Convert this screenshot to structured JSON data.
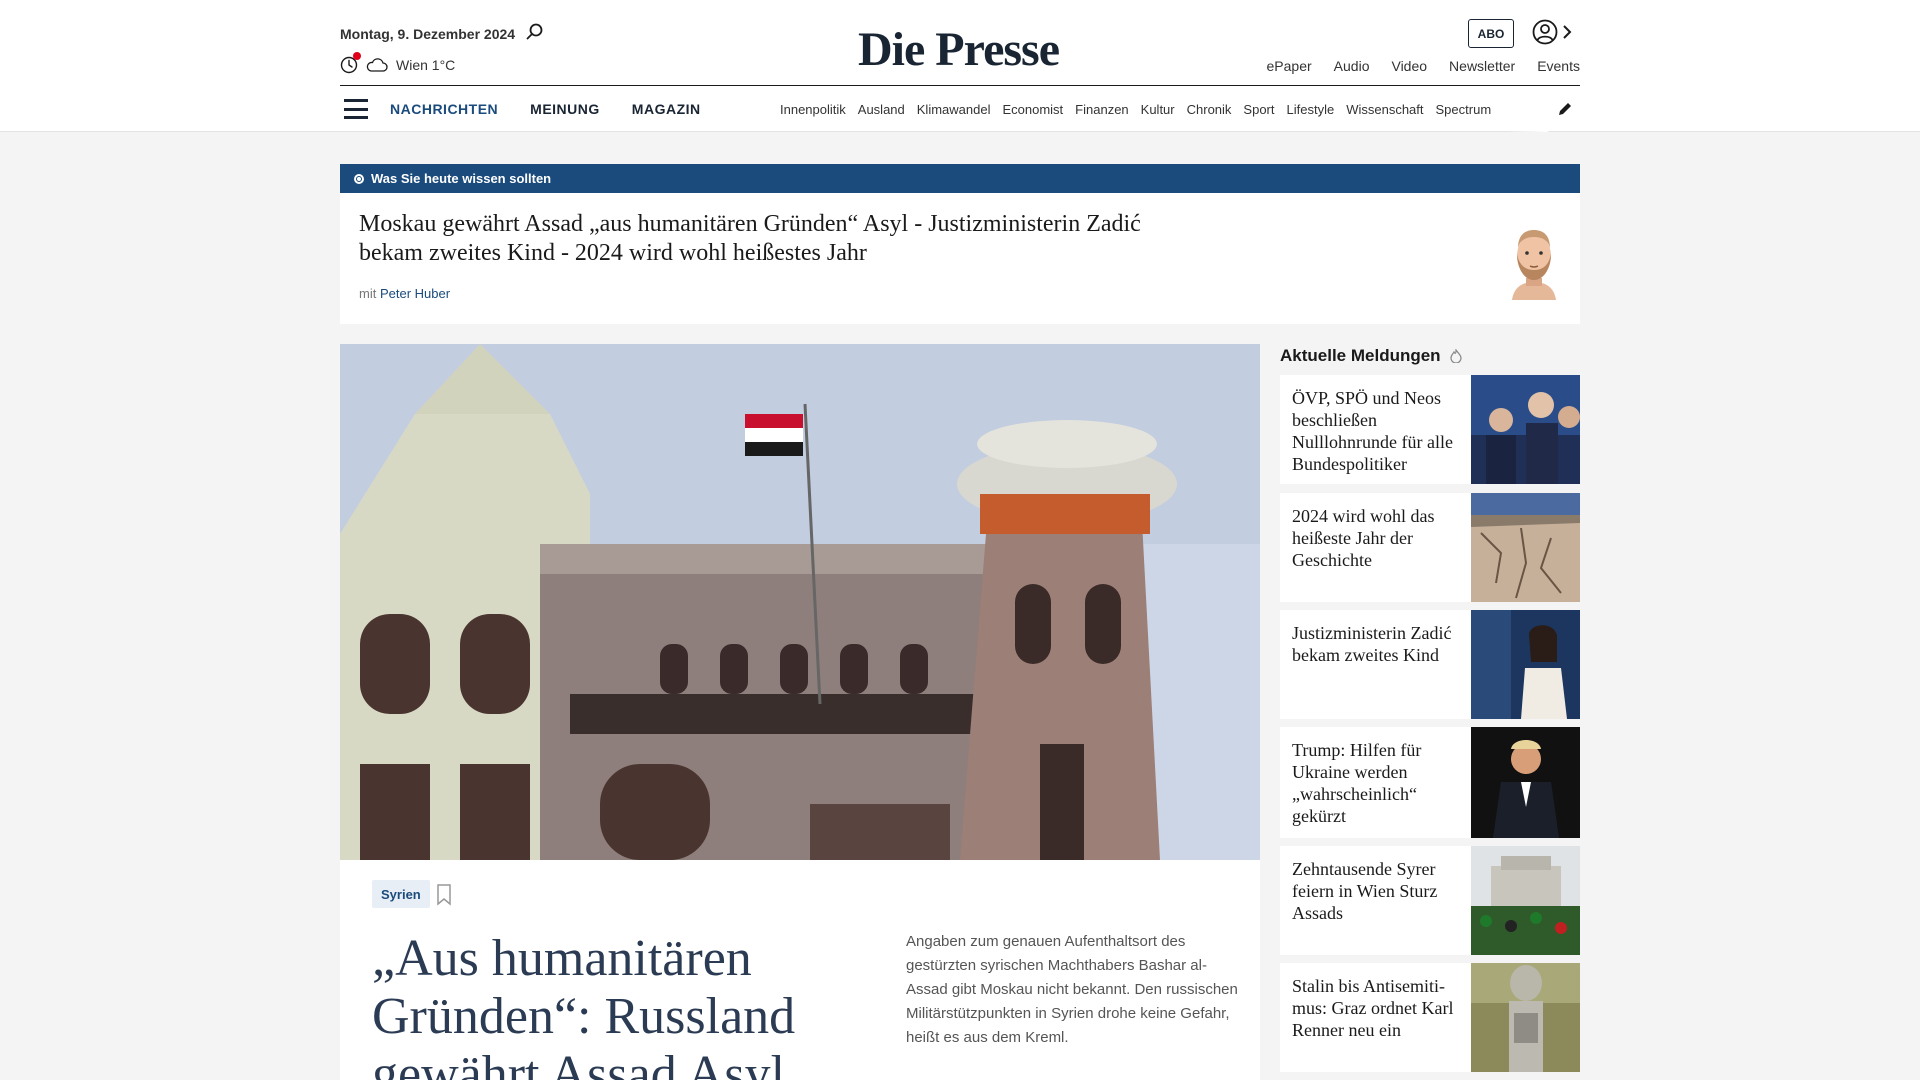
{
  "header": {
    "date": "Montag, 9. Dezember 2024",
    "weather": "Wien 1°C",
    "logo": "Die Presse",
    "abo_label": "ABO",
    "top_links": [
      "ePaper",
      "Audio",
      "Video",
      "Newsletter",
      "Events"
    ]
  },
  "nav": {
    "main": [
      "NACHRICHTEN",
      "MEINUNG",
      "MAGAZIN"
    ],
    "sections": [
      "Innenpolitik",
      "Ausland",
      "Klimawandel",
      "Economist",
      "Finanzen",
      "Kultur",
      "Chronik",
      "Sport",
      "Lifestyle",
      "Wissenschaft",
      "Spectrum"
    ]
  },
  "briefing": {
    "label": "Was Sie heute wissen sollten",
    "title": "Moskau gewährt Assad „aus humanitären Gründen“ Asyl - Justizministerin Zadić bekam zweites Kind - 2024 wird wohl heißestes Jahr",
    "by_prefix": "mit",
    "author": "Peter Huber"
  },
  "lead": {
    "tag": "Syrien",
    "headline": "„Aus humanitären Gründen“: Russland gewährt Assad Asyl",
    "teaser": "Angaben zum genauen Aufenthaltsort des gestürzten syrischen Machthabers Bashar al-Assad gibt Moskau nicht bekannt. Den russischen Militärstützpunkten in Syrien drohe keine Gefahr, heißt es aus dem Kreml."
  },
  "sidebar": {
    "heading": "Aktuelle Meldungen",
    "items": [
      {
        "title": "ÖVP, SPÖ und Neos beschließen Nulllohnrunde für alle Bundespolitiker"
      },
      {
        "title": "2024 wird wohl das heißeste Jahr der Geschichte"
      },
      {
        "title": "Justizministerin Zadić bekam zweites Kind"
      },
      {
        "title": "Trump: Hilfen für Ukraine werden „wahrscheinlich“ gekürzt"
      },
      {
        "title": "Zehntausende Syrer feiern in Wien Sturz Assads"
      },
      {
        "title": "Stalin bis Antisemiti­mus: Graz ordnet Karl Renner neu ein"
      }
    ]
  },
  "colors": {
    "brand_blue": "#1a4b7c",
    "alert_red": "#e0001b",
    "headline_blue": "#2b3b53"
  }
}
